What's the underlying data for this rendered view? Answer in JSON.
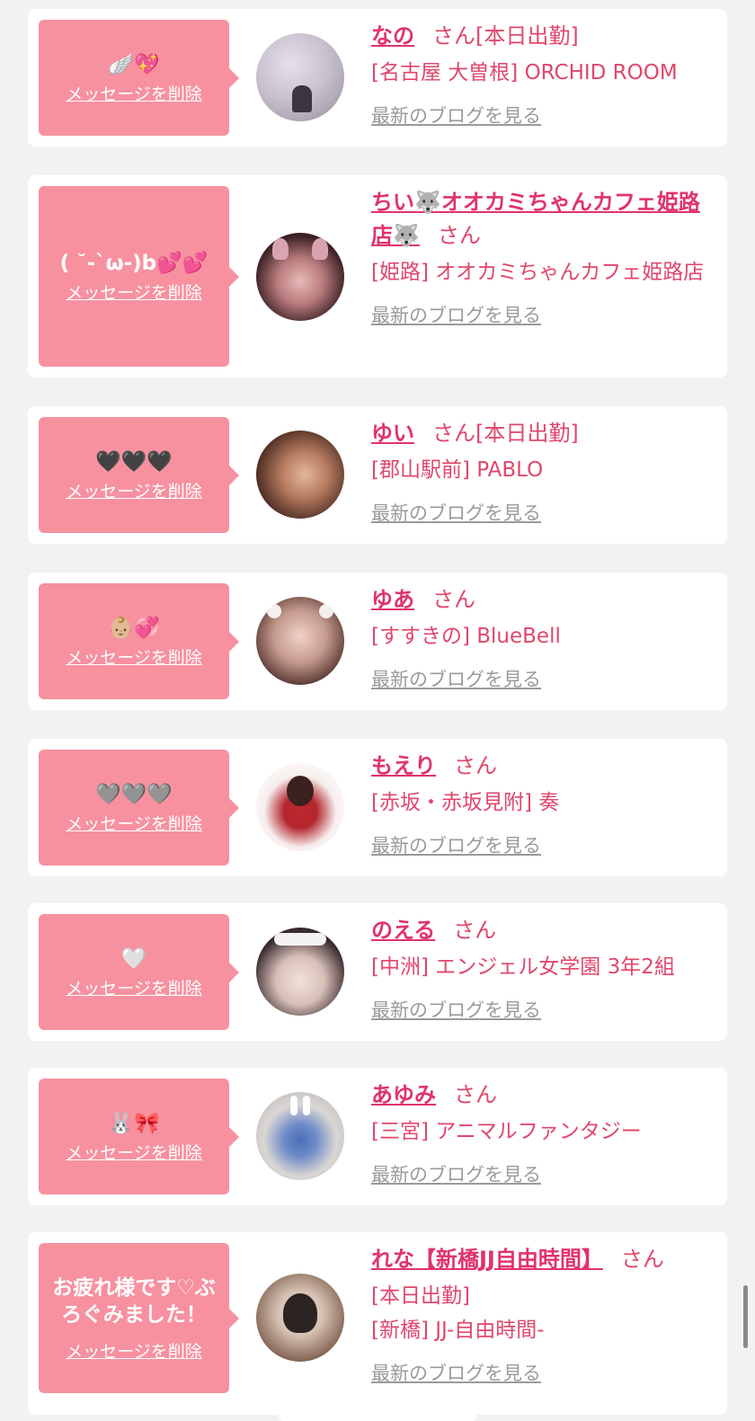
{
  "colors": {
    "accent": "#e0336b",
    "bubble": "#f7919f",
    "card": "#ffffff",
    "page": "#f2f2f2",
    "link_gray": "#9a9a9a"
  },
  "delete_label": "メッセージを削除",
  "blog_label": "最新のブログを見る",
  "san": "さん",
  "entries": [
    {
      "message": "🪽💖",
      "name": "なの",
      "attendance": "[本日出勤]",
      "lines": [
        "[名古屋 大曽根] ORCHID ROOM"
      ]
    },
    {
      "message": "( ˘-`ω-)b💕💕",
      "name": "ちい🐺オオカミちゃんカフェ姫路店🐺",
      "attendance": "",
      "lines": [
        "[姫路] オオカミちゃんカフェ姫路店"
      ]
    },
    {
      "message": "🖤🖤🖤",
      "name": "ゆい",
      "attendance": "[本日出勤]",
      "lines": [
        "[郡山駅前] PABLO"
      ]
    },
    {
      "message": "👶🏼💞",
      "name": "ゆあ",
      "attendance": "",
      "lines": [
        "[すすきの] BlueBell"
      ]
    },
    {
      "message": "🩶🩶🩶",
      "name": "もえり",
      "attendance": "",
      "lines": [
        "[赤坂・赤坂見附] 奏"
      ]
    },
    {
      "message": "🤍",
      "name": "のえる",
      "attendance": "",
      "lines": [
        "[中洲] エンジェル女学園 3年2組"
      ]
    },
    {
      "message": "🐰🎀",
      "name": "あゆみ",
      "attendance": "",
      "lines": [
        "[三宮] アニマルファンタジー"
      ]
    },
    {
      "message": "お疲れ様です♡ぶろぐみました！",
      "name": "れな【新橋JJ自由時間】",
      "attendance": "",
      "lines": [
        "[本日出勤]",
        "[新橋] JJ-自由時間-"
      ]
    }
  ]
}
